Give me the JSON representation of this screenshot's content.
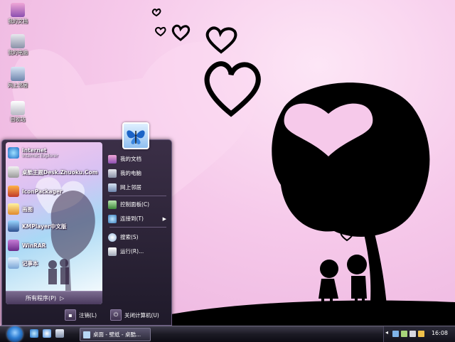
{
  "desktop_icons": [
    {
      "label": "我的文档",
      "icon": "my-documents-icon"
    },
    {
      "label": "我的电脑",
      "icon": "my-computer-icon"
    },
    {
      "label": "网上邻居",
      "icon": "network-icon"
    },
    {
      "label": "回收站",
      "icon": "recycle-bin-icon"
    }
  ],
  "start_menu": {
    "programs": [
      {
        "label": "Internet",
        "sub": "Internet Explorer",
        "icon": "internet-explorer-icon"
      },
      {
        "label": "桌酷主题Desk.Zhuoku.Com",
        "sub": "",
        "icon": "zhuoku-icon"
      },
      {
        "label": "IconPackager",
        "sub": "",
        "icon": "iconpackager-icon"
      },
      {
        "label": "画图",
        "sub": "",
        "icon": "paint-icon"
      },
      {
        "label": "KMPlayer中文版",
        "sub": "",
        "icon": "kmplayer-icon"
      },
      {
        "label": "WinRAR",
        "sub": "",
        "icon": "winrar-icon"
      },
      {
        "label": "记事本",
        "sub": "",
        "icon": "notepad-icon"
      }
    ],
    "all_programs": "所有程序(P)",
    "places": [
      {
        "label": "我的文档",
        "icon": "my-documents-icon"
      },
      {
        "label": "我的电脑",
        "icon": "my-computer-icon"
      },
      {
        "label": "网上邻居",
        "icon": "network-icon"
      },
      {
        "label": "控制面板(C)",
        "icon": "control-panel-icon"
      },
      {
        "label": "连接到(T)",
        "icon": "connect-to-icon",
        "submenu": true
      },
      {
        "label": "搜索(S)",
        "icon": "search-icon"
      },
      {
        "label": "运行(R)...",
        "icon": "run-icon"
      }
    ],
    "logoff": "注销(L)",
    "shutdown": "关闭计算机(U)"
  },
  "taskbar": {
    "task_button": "桌面 - 壁纸 - 桌酷...",
    "clock": "16:08"
  },
  "colors": {
    "wallpaper_pink": "#f6c9ea",
    "silhouette": "#000000",
    "taskbar": "#1b1a24",
    "start_menu": "#2f2540"
  }
}
